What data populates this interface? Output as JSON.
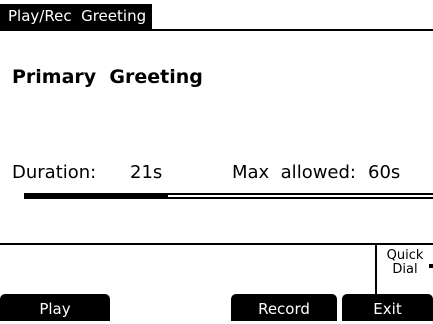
{
  "title": "Play/Rec  Greeting",
  "heading": "Primary  Greeting",
  "duration": {
    "label": "Duration:",
    "value": "21s"
  },
  "max_allowed": {
    "label": "Max  allowed:",
    "value": "60s"
  },
  "progress": {
    "fraction": 0.35
  },
  "quick_dial": {
    "line1": "Quick",
    "line2": "Dial"
  },
  "softkeys": {
    "play": "Play",
    "record": "Record",
    "exit": "Exit"
  }
}
